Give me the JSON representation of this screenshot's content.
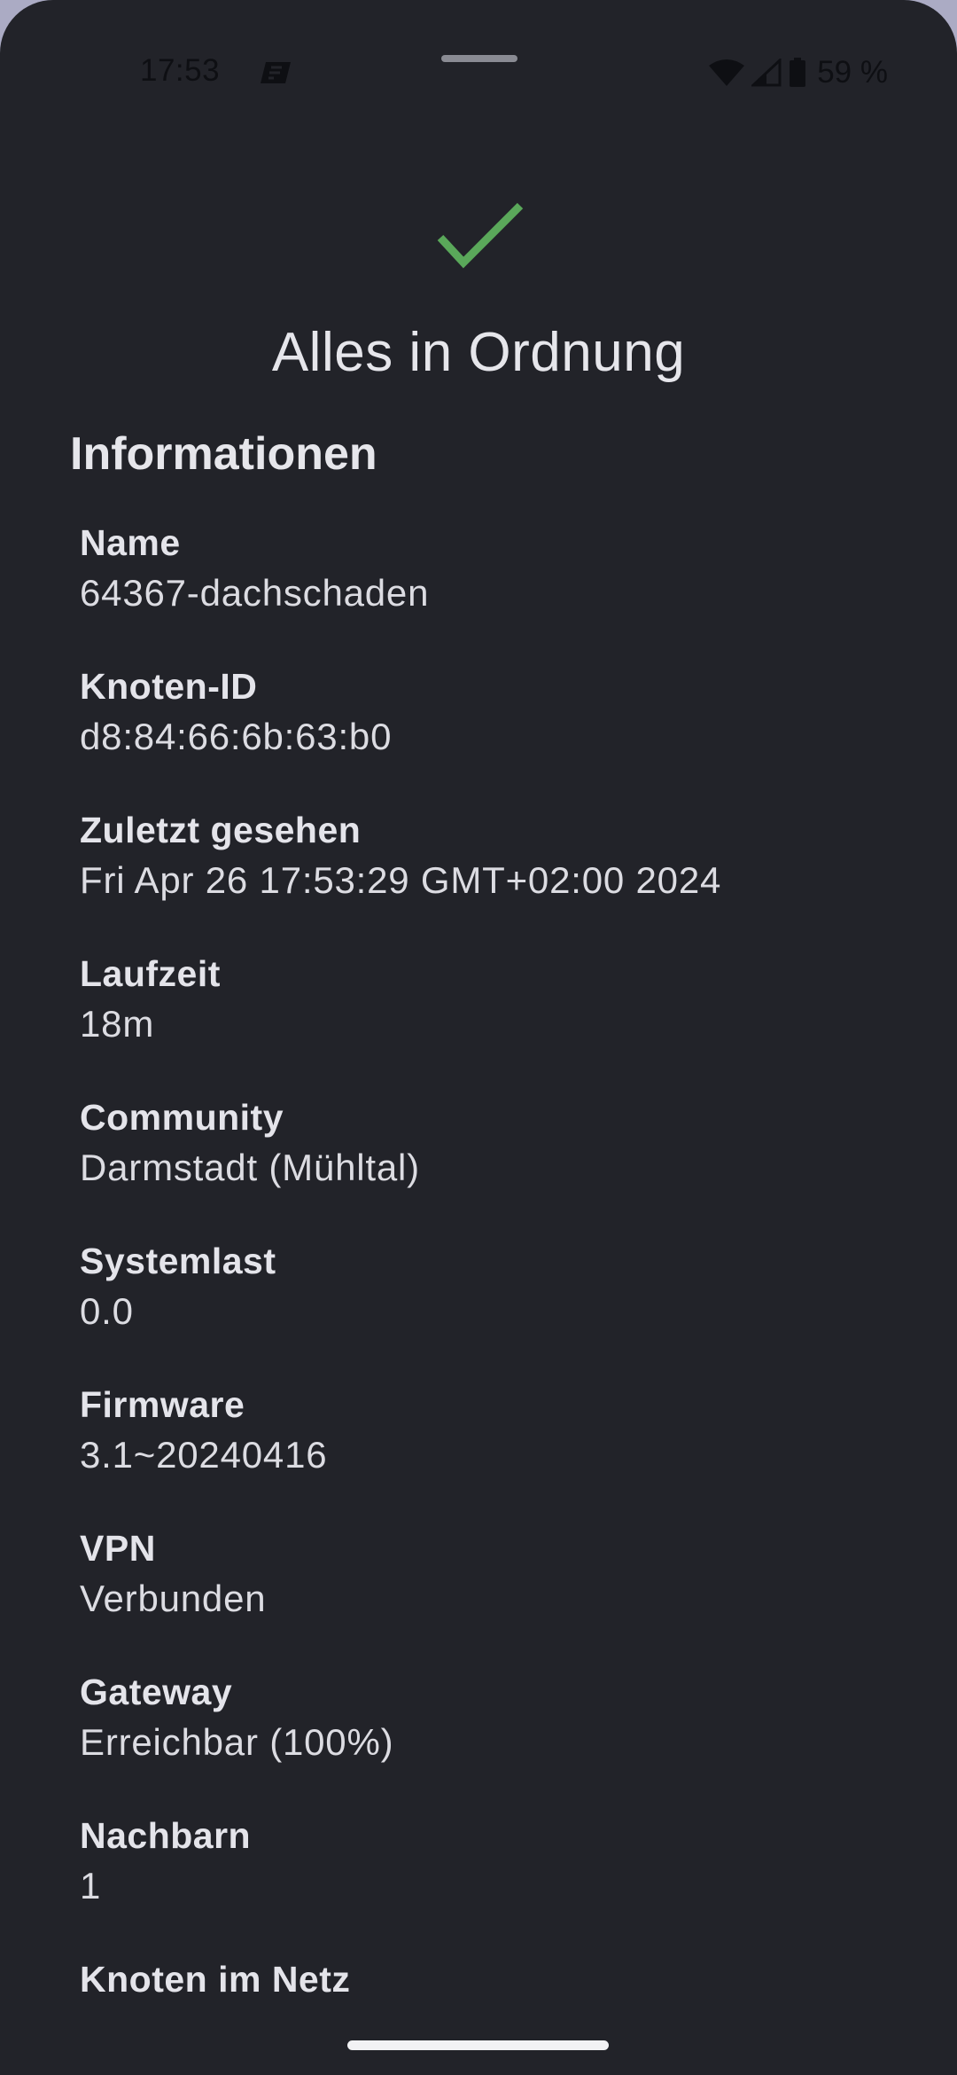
{
  "status_bar": {
    "time": "17:53",
    "battery_text": "59 %",
    "icons": [
      "app-notification-icon",
      "wifi-icon",
      "cell-signal-icon",
      "battery-icon"
    ]
  },
  "header": {
    "status_icon": "check-icon",
    "status_color": "#5aa85a",
    "status_text": "Alles in Ordnung"
  },
  "section": {
    "title": "Informationen"
  },
  "info": [
    {
      "label": "Name",
      "value": "64367-dachschaden"
    },
    {
      "label": "Knoten-ID",
      "value": "d8:84:66:6b:63:b0"
    },
    {
      "label": "Zuletzt gesehen",
      "value": "Fri Apr 26 17:53:29 GMT+02:00 2024"
    },
    {
      "label": "Laufzeit",
      "value": "18m"
    },
    {
      "label": "Community",
      "value": "Darmstadt (Mühltal)"
    },
    {
      "label": "Systemlast",
      "value": "0.0"
    },
    {
      "label": "Firmware",
      "value": "3.1~20240416"
    },
    {
      "label": "VPN",
      "value": "Verbunden"
    },
    {
      "label": "Gateway",
      "value": "Erreichbar (100%)"
    },
    {
      "label": "Nachbarn",
      "value": "1"
    },
    {
      "label": "Knoten im Netz",
      "value": ""
    }
  ]
}
